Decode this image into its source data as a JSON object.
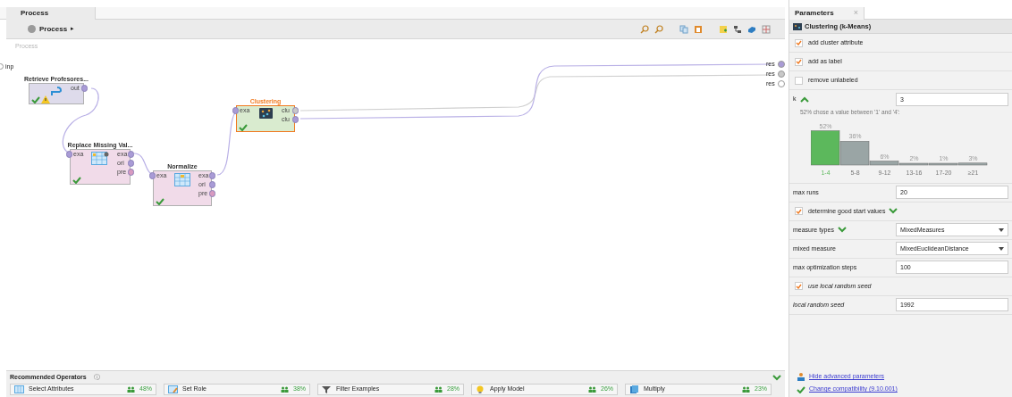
{
  "process_panel": {
    "tab": {
      "label": "Process",
      "selected": true
    },
    "breadcrumb": "Process",
    "breadcrumb_arrow": "▸",
    "canvas_title": "Process",
    "input_port": "inp",
    "output_ports": [
      {
        "label": "res",
        "color": "#a99bd6"
      },
      {
        "label": "res",
        "color": "#c8c8c8"
      },
      {
        "label": "res",
        "color": "#ffffff"
      }
    ],
    "operators": [
      {
        "name": "Retrieve Profesores...",
        "selected": false,
        "ok": true,
        "warning": true,
        "right_ports": [
          {
            "label": "out",
            "color": "#a99bd6"
          }
        ]
      },
      {
        "name": "Replace Missing Val...",
        "selected": false,
        "ok": true,
        "warning": false,
        "left_ports": [
          {
            "label": "exa",
            "color": "#a99bd6"
          }
        ],
        "right_ports": [
          {
            "label": "exa",
            "color": "#a99bd6"
          },
          {
            "label": "ori",
            "color": "#a99bd6"
          },
          {
            "label": "pre",
            "color": "#d89ac0"
          }
        ]
      },
      {
        "name": "Normalize",
        "selected": false,
        "ok": true,
        "warning": false,
        "left_ports": [
          {
            "label": "exa",
            "color": "#a99bd6"
          }
        ],
        "right_ports": [
          {
            "label": "exa",
            "color": "#a99bd6"
          },
          {
            "label": "ori",
            "color": "#a99bd6"
          },
          {
            "label": "pre",
            "color": "#d89ac0"
          }
        ]
      },
      {
        "name": "Clustering",
        "selected": true,
        "ok": true,
        "warning": false,
        "left_ports": [
          {
            "label": "exa",
            "color": "#a99bd6"
          }
        ],
        "right_ports": [
          {
            "label": "clu",
            "color": "#c8c8c8"
          },
          {
            "label": "clu",
            "color": "#a99bd6"
          }
        ]
      }
    ]
  },
  "recommended_operators": {
    "title": "Recommended Operators",
    "info": "ⓘ",
    "expanded": true,
    "items": [
      {
        "name": "Select Attributes",
        "share": "48%"
      },
      {
        "name": "Set Role",
        "share": "38%"
      },
      {
        "name": "Filter Examples",
        "share": "28%"
      },
      {
        "name": "Apply Model",
        "share": "26%"
      },
      {
        "name": "Multiply",
        "share": "23%"
      }
    ]
  },
  "parameters_panel": {
    "tab": {
      "label": "Parameters",
      "close": "×",
      "selected": true
    },
    "operator": "Clustering (k-Means)",
    "parameters": [
      {
        "kind": "checkbox",
        "label": "add cluster attribute",
        "checked": true,
        "italic": false
      },
      {
        "kind": "checkbox",
        "label": "add as label",
        "checked": true,
        "italic": false
      },
      {
        "kind": "checkbox",
        "label": "remove unlabeled",
        "checked": false,
        "italic": false
      },
      {
        "kind": "field",
        "label": "k",
        "value": "3",
        "italic": false,
        "expanded": true,
        "caption": "52% chose a value between '1' and '4':",
        "chart_data": {
          "type": "bar",
          "categories": [
            "1-4",
            "5-8",
            "9-12",
            "13-16",
            "17-20",
            "≥21"
          ],
          "stacked": true,
          "series": [
            {
              "color": "#5cb85c",
              "values": [
                52,
                null,
                null,
                null,
                null,
                null
              ],
              "value_labels": [
                "52%",
                null,
                null,
                null,
                null,
                null
              ]
            },
            {
              "color": "#9aa5a5",
              "values": [
                null,
                36,
                6,
                2,
                1,
                3
              ],
              "value_labels": [
                null,
                "36%",
                "6%",
                "2%",
                "1%",
                "3%"
              ]
            }
          ]
        }
      },
      {
        "kind": "field",
        "label": "max runs",
        "value": "20",
        "italic": false
      },
      {
        "kind": "checkbox",
        "label": "determine good start values",
        "checked": true,
        "italic": false,
        "expanded": false
      },
      {
        "kind": "dropdown",
        "label": "measure types",
        "value": "MixedMeasures",
        "italic": false,
        "expanded": false
      },
      {
        "kind": "dropdown",
        "label": "mixed measure",
        "value": "MixedEuclideanDistance",
        "italic": false
      },
      {
        "kind": "field",
        "label": "max optimization steps",
        "value": "100",
        "italic": false
      },
      {
        "kind": "checkbox",
        "label": "use local random seed",
        "checked": true,
        "italic": true
      },
      {
        "kind": "field",
        "label": "local random seed",
        "value": "1992",
        "italic": true
      }
    ],
    "links": [
      {
        "label": "Hide advanced parameters",
        "kind": "advanced"
      },
      {
        "label": "Change compatibility (9.10.001)",
        "kind": "compatibility"
      }
    ]
  }
}
